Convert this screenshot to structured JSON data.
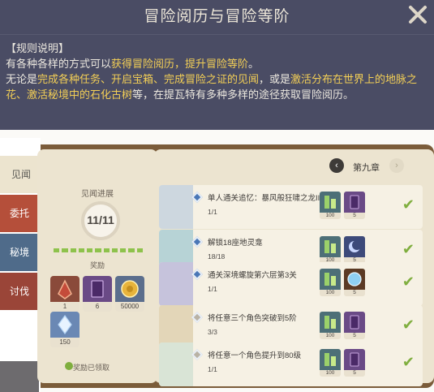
{
  "dialog": {
    "title": "冒险阅历与冒险等阶",
    "rules_heading": "【规则说明】",
    "line1_pre": "有各种各样的方式可以",
    "line1_hl": "获得冒险阅历，提升冒险等阶",
    "line1_post": "。",
    "line2_pre": "无论是",
    "line2_hl1": "完成各种任务、开启宝箱、完成冒险之证的见闻",
    "line2_mid": "，或是",
    "line2_hl2": "激活分布在世界上的地脉之花、激活秘境中的石化古树",
    "line2_post": "等，在提瓦特有多种多样的途径获取冒险阅历。"
  },
  "tabs": [
    {
      "label": "见闻"
    },
    {
      "label": "委托"
    },
    {
      "label": "秘境"
    },
    {
      "label": "讨伐"
    }
  ],
  "left_page": {
    "progress_title": "见闻进展",
    "progress_text": "11/11",
    "progress_done": 11,
    "progress_total": 11,
    "reward_label": "奖励",
    "rewards": [
      {
        "icon": "gem-icon",
        "count": "1"
      },
      {
        "icon": "book-icon",
        "count": "6"
      },
      {
        "icon": "mora-coin-icon",
        "count": "50000"
      },
      {
        "icon": "crystal-icon",
        "count": "150"
      }
    ],
    "claimed_text": "奖励已领取"
  },
  "chapter": {
    "label": "第九章"
  },
  "achievements": [
    {
      "title": "单人通关追忆：暴风般狂啸之龙III",
      "count": "1/1",
      "reward1": "100",
      "reward2": "5",
      "r2icon": "book-icon"
    },
    {
      "title": "解锁18座地灵龛",
      "count": "18/18",
      "reward1": "100",
      "reward2": "5",
      "r2icon": "moon-icon"
    },
    {
      "title": "通关深境螺旋第六层第3关",
      "count": "1/1",
      "reward1": "100",
      "reward2": "5",
      "r2icon": "orb-icon"
    },
    {
      "title": "将任意三个角色突破到5阶",
      "count": "3/3",
      "reward1": "100",
      "reward2": "5",
      "r2icon": "book-icon"
    },
    {
      "title": "将任意一个角色提升到80级",
      "count": "1/1",
      "reward1": "100",
      "reward2": "5",
      "r2icon": "book-icon"
    }
  ],
  "colors": {
    "highlight": "#f3cf56",
    "dialog_bg": "#4a4c64",
    "check": "#7fae3e"
  }
}
